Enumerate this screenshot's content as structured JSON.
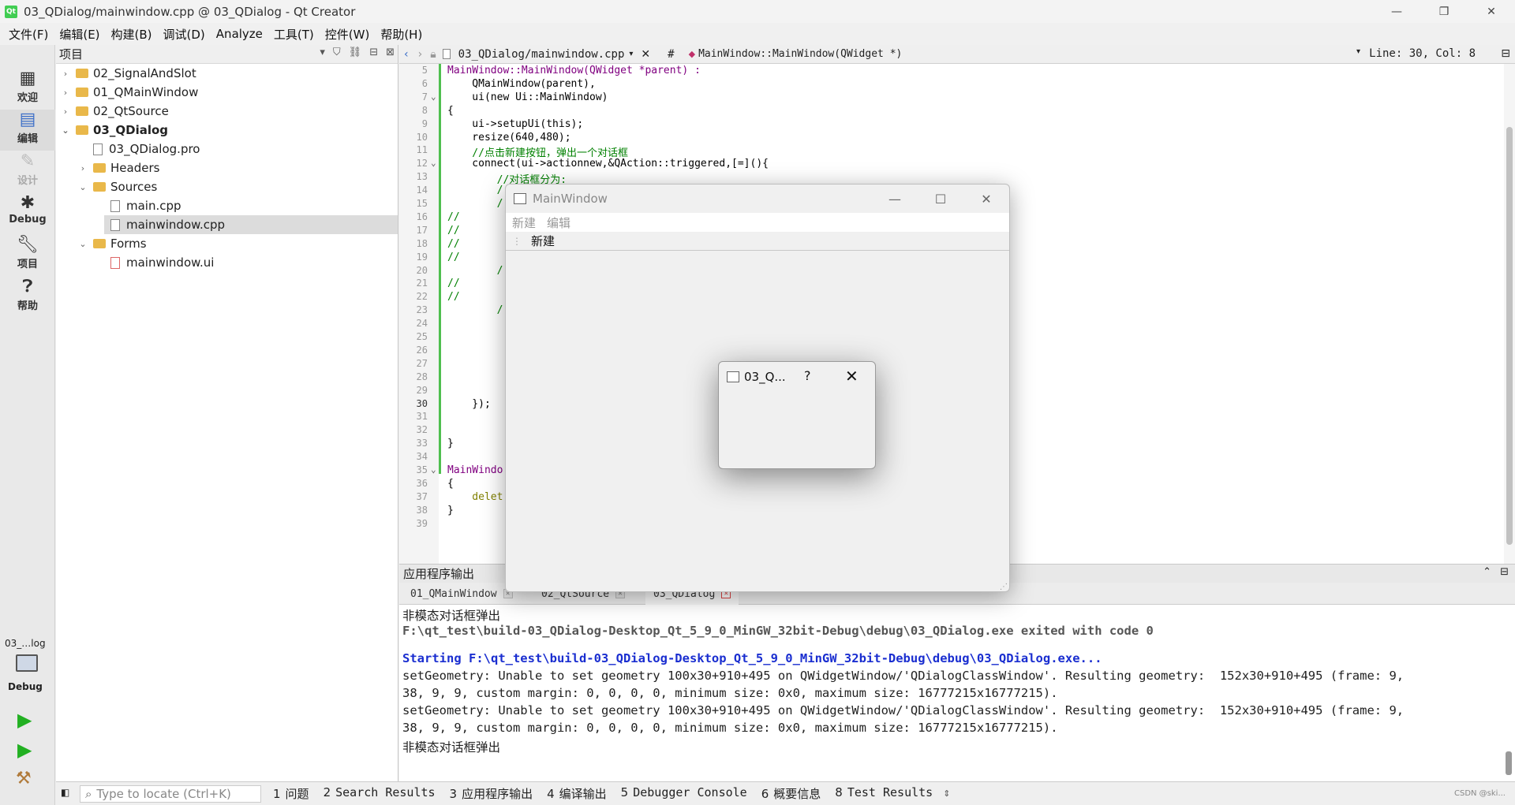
{
  "window": {
    "title": "03_QDialog/mainwindow.cpp @ 03_QDialog - Qt Creator",
    "app_icon": "Qt",
    "minimize": "—",
    "restore": "❐",
    "close": "✕"
  },
  "menubar": [
    "文件(F)",
    "编辑(E)",
    "构建(B)",
    "调试(D)",
    "Analyze",
    "工具(T)",
    "控件(W)",
    "帮助(H)"
  ],
  "modes": [
    {
      "label": "欢迎",
      "icon": "grid-icon"
    },
    {
      "label": "编辑",
      "icon": "edit-icon"
    },
    {
      "label": "设计",
      "icon": "pen-icon"
    },
    {
      "label": "Debug",
      "icon": "bug-icon"
    },
    {
      "label": "项目",
      "icon": "wrench-icon"
    },
    {
      "label": "帮助",
      "icon": "help-icon"
    }
  ],
  "run_target": {
    "project": "03_…log",
    "mode": "Debug"
  },
  "project_pane": {
    "title": "项目",
    "tree": [
      {
        "label": "02_SignalAndSlot",
        "kind": "project",
        "expanded": false
      },
      {
        "label": "01_QMainWindow",
        "kind": "project",
        "expanded": false
      },
      {
        "label": "02_QtSource",
        "kind": "project",
        "expanded": false
      },
      {
        "label": "03_QDialog",
        "kind": "project",
        "expanded": true
      },
      {
        "label": "03_QDialog.pro",
        "kind": "profile"
      },
      {
        "label": "Headers",
        "kind": "folder",
        "expanded": false
      },
      {
        "label": "Sources",
        "kind": "folder",
        "expanded": true
      },
      {
        "label": "main.cpp",
        "kind": "file"
      },
      {
        "label": "mainwindow.cpp",
        "kind": "file",
        "selected": true
      },
      {
        "label": "Forms",
        "kind": "folder",
        "expanded": true
      },
      {
        "label": "mainwindow.ui",
        "kind": "uifile"
      }
    ]
  },
  "editor_toolbar": {
    "file": "03_QDialog/mainwindow.cpp",
    "hash": "#",
    "symbol": "MainWindow::MainWindow(QWidget *)",
    "position": "Line: 30, Col: 8"
  },
  "code_lines": [
    {
      "n": "5",
      "text": "MainWindow::MainWindow(QWidget *parent) :"
    },
    {
      "n": "6",
      "text": "    QMainWindow(parent),"
    },
    {
      "n": "7",
      "text": "    ui(new Ui::MainWindow)"
    },
    {
      "n": "8",
      "text": "{"
    },
    {
      "n": "9",
      "text": "    ui->setupUi(this);"
    },
    {
      "n": "10",
      "text": "    resize(640,480);"
    },
    {
      "n": "11",
      "text": "    //点击新建按钮，弹出一个对话框"
    },
    {
      "n": "12",
      "text": "    connect(ui->actionnew,&QAction::triggered,[=](){"
    },
    {
      "n": "13",
      "text": "        //对话框分为:"
    },
    {
      "n": "14",
      "text": "        /"
    },
    {
      "n": "15",
      "text": "        /"
    },
    {
      "n": "16",
      "text": "//"
    },
    {
      "n": "17",
      "text": "//"
    },
    {
      "n": "18",
      "text": "//"
    },
    {
      "n": "19",
      "text": "//"
    },
    {
      "n": "20",
      "text": "        /"
    },
    {
      "n": "21",
      "text": "//"
    },
    {
      "n": "22",
      "text": "//"
    },
    {
      "n": "23",
      "text": "        /"
    },
    {
      "n": "24",
      "text": ""
    },
    {
      "n": "25",
      "text": ""
    },
    {
      "n": "26",
      "text": ""
    },
    {
      "n": "27",
      "text": ""
    },
    {
      "n": "28",
      "text": ""
    },
    {
      "n": "29",
      "text": ""
    },
    {
      "n": "30",
      "text": "    });"
    },
    {
      "n": "31",
      "text": ""
    },
    {
      "n": "32",
      "text": ""
    },
    {
      "n": "33",
      "text": "}"
    },
    {
      "n": "34",
      "text": ""
    },
    {
      "n": "35",
      "text": "MainWindo"
    },
    {
      "n": "36",
      "text": "{"
    },
    {
      "n": "37",
      "text": "    delet"
    },
    {
      "n": "38",
      "text": "}"
    },
    {
      "n": "39",
      "text": ""
    }
  ],
  "output": {
    "title": "应用程序输出",
    "tabs": [
      "01_QMainWindow",
      "02_QtSource",
      "03_QDialog"
    ],
    "lines": [
      {
        "text": "非模态对话框弹出",
        "style": "cn"
      },
      {
        "text": "F:\\qt_test\\build-03_QDialog-Desktop_Qt_5_9_0_MinGW_32bit-Debug\\debug\\03_QDialog.exe exited with code 0",
        "style": "gray"
      },
      {
        "text": "",
        "style": ""
      },
      {
        "text": "Starting F:\\qt_test\\build-03_QDialog-Desktop_Qt_5_9_0_MinGW_32bit-Debug\\debug\\03_QDialog.exe...",
        "style": "blue"
      },
      {
        "text": "setGeometry: Unable to set geometry 100x30+910+495 on QWidgetWindow/'QDialogClassWindow'. Resulting geometry:  152x30+910+495 (frame: 9,",
        "style": ""
      },
      {
        "text": "38, 9, 9, custom margin: 0, 0, 0, 0, minimum size: 0x0, maximum size: 16777215x16777215).",
        "style": ""
      },
      {
        "text": "setGeometry: Unable to set geometry 100x30+910+495 on QWidgetWindow/'QDialogClassWindow'. Resulting geometry:  152x30+910+495 (frame: 9,",
        "style": ""
      },
      {
        "text": "38, 9, 9, custom margin: 0, 0, 0, 0, minimum size: 0x0, maximum size: 16777215x16777215).",
        "style": ""
      },
      {
        "text": "非模态对话框弹出",
        "style": "cn"
      }
    ]
  },
  "statusbar": {
    "locate_placeholder": "Type to locate (Ctrl+K)",
    "panes": [
      {
        "n": "1",
        "label": "问题"
      },
      {
        "n": "2",
        "label": "Search Results"
      },
      {
        "n": "3",
        "label": "应用程序输出"
      },
      {
        "n": "4",
        "label": "编译输出"
      },
      {
        "n": "5",
        "label": "Debugger Console"
      },
      {
        "n": "6",
        "label": "概要信息"
      },
      {
        "n": "8",
        "label": "Test Results"
      }
    ],
    "watermark": "CSDN @ski..."
  },
  "mainwindow": {
    "title": "MainWindow",
    "menu": [
      "新建",
      "编辑"
    ],
    "toolbar_action": "新建"
  },
  "dialog": {
    "title": "03_Q...",
    "help": "?",
    "close": "✕"
  }
}
